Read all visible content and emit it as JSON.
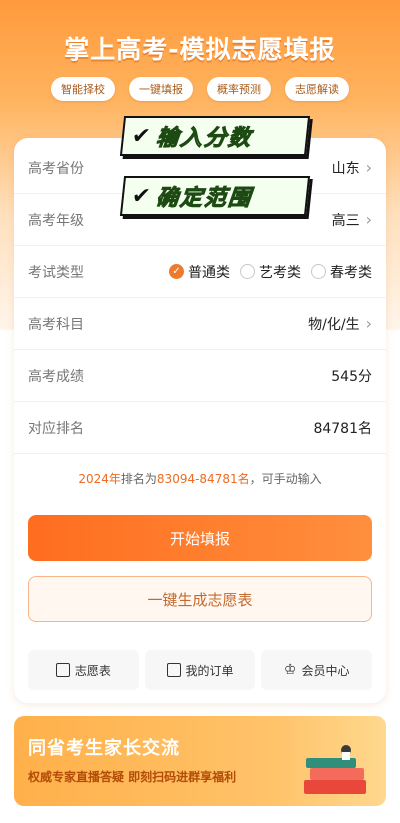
{
  "header": {
    "title": "掌上高考-模拟志愿填报",
    "tags": [
      "智能择校",
      "一键填报",
      "概率预测",
      "志愿解读"
    ]
  },
  "stamps": {
    "first": "输入分数",
    "second": "确定范围"
  },
  "form": {
    "province": {
      "label": "高考省份",
      "value": "山东"
    },
    "grade": {
      "label": "高考年级",
      "value": "高三"
    },
    "exam_type": {
      "label": "考试类型",
      "options": [
        "普通类",
        "艺考类",
        "春考类"
      ],
      "selected": "普通类"
    },
    "subjects": {
      "label": "高考科目",
      "value": "物/化/生"
    },
    "score": {
      "label": "高考成绩",
      "value": "545分"
    },
    "rank": {
      "label": "对应排名",
      "value": "84781名"
    }
  },
  "note": {
    "year": "2024年",
    "text1": "排名为",
    "range": "83094-84781名",
    "text2": "，可手动输入"
  },
  "actions": {
    "start": "开始填报",
    "generate": "一键生成志愿表"
  },
  "quick": [
    "志愿表",
    "我的订单",
    "会员中心"
  ],
  "banner": {
    "title": "同省考生家长交流",
    "subtitle": "权威专家直播答疑  即刻扫码进群享福利"
  },
  "colors": {
    "accent": "#f07a2b",
    "stamp_text": "#7bd13a"
  }
}
